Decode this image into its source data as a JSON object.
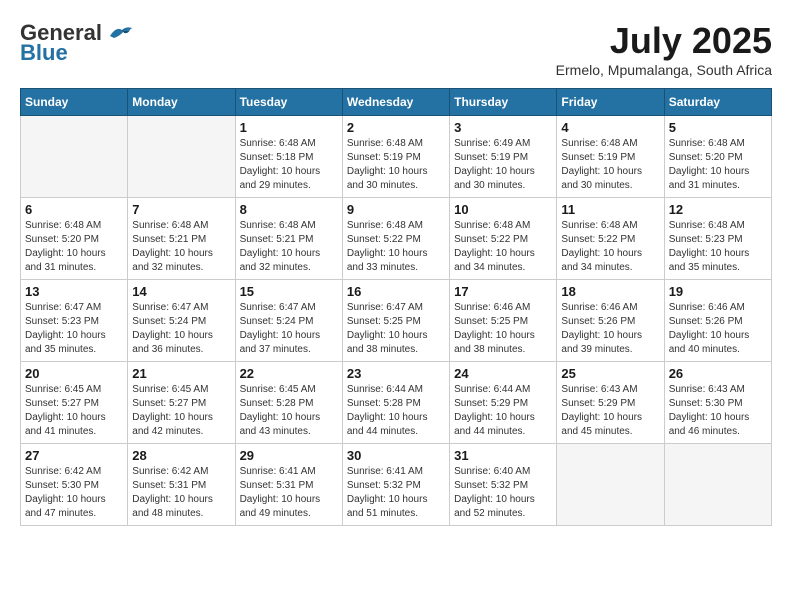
{
  "logo": {
    "general": "General",
    "blue": "Blue"
  },
  "title": {
    "month_year": "July 2025",
    "location": "Ermelo, Mpumalanga, South Africa"
  },
  "weekdays": [
    "Sunday",
    "Monday",
    "Tuesday",
    "Wednesday",
    "Thursday",
    "Friday",
    "Saturday"
  ],
  "weeks": [
    [
      {
        "day": "",
        "info": ""
      },
      {
        "day": "",
        "info": ""
      },
      {
        "day": "1",
        "info": "Sunrise: 6:48 AM\nSunset: 5:18 PM\nDaylight: 10 hours\nand 29 minutes."
      },
      {
        "day": "2",
        "info": "Sunrise: 6:48 AM\nSunset: 5:19 PM\nDaylight: 10 hours\nand 30 minutes."
      },
      {
        "day": "3",
        "info": "Sunrise: 6:49 AM\nSunset: 5:19 PM\nDaylight: 10 hours\nand 30 minutes."
      },
      {
        "day": "4",
        "info": "Sunrise: 6:48 AM\nSunset: 5:19 PM\nDaylight: 10 hours\nand 30 minutes."
      },
      {
        "day": "5",
        "info": "Sunrise: 6:48 AM\nSunset: 5:20 PM\nDaylight: 10 hours\nand 31 minutes."
      }
    ],
    [
      {
        "day": "6",
        "info": "Sunrise: 6:48 AM\nSunset: 5:20 PM\nDaylight: 10 hours\nand 31 minutes."
      },
      {
        "day": "7",
        "info": "Sunrise: 6:48 AM\nSunset: 5:21 PM\nDaylight: 10 hours\nand 32 minutes."
      },
      {
        "day": "8",
        "info": "Sunrise: 6:48 AM\nSunset: 5:21 PM\nDaylight: 10 hours\nand 32 minutes."
      },
      {
        "day": "9",
        "info": "Sunrise: 6:48 AM\nSunset: 5:22 PM\nDaylight: 10 hours\nand 33 minutes."
      },
      {
        "day": "10",
        "info": "Sunrise: 6:48 AM\nSunset: 5:22 PM\nDaylight: 10 hours\nand 34 minutes."
      },
      {
        "day": "11",
        "info": "Sunrise: 6:48 AM\nSunset: 5:22 PM\nDaylight: 10 hours\nand 34 minutes."
      },
      {
        "day": "12",
        "info": "Sunrise: 6:48 AM\nSunset: 5:23 PM\nDaylight: 10 hours\nand 35 minutes."
      }
    ],
    [
      {
        "day": "13",
        "info": "Sunrise: 6:47 AM\nSunset: 5:23 PM\nDaylight: 10 hours\nand 35 minutes."
      },
      {
        "day": "14",
        "info": "Sunrise: 6:47 AM\nSunset: 5:24 PM\nDaylight: 10 hours\nand 36 minutes."
      },
      {
        "day": "15",
        "info": "Sunrise: 6:47 AM\nSunset: 5:24 PM\nDaylight: 10 hours\nand 37 minutes."
      },
      {
        "day": "16",
        "info": "Sunrise: 6:47 AM\nSunset: 5:25 PM\nDaylight: 10 hours\nand 38 minutes."
      },
      {
        "day": "17",
        "info": "Sunrise: 6:46 AM\nSunset: 5:25 PM\nDaylight: 10 hours\nand 38 minutes."
      },
      {
        "day": "18",
        "info": "Sunrise: 6:46 AM\nSunset: 5:26 PM\nDaylight: 10 hours\nand 39 minutes."
      },
      {
        "day": "19",
        "info": "Sunrise: 6:46 AM\nSunset: 5:26 PM\nDaylight: 10 hours\nand 40 minutes."
      }
    ],
    [
      {
        "day": "20",
        "info": "Sunrise: 6:45 AM\nSunset: 5:27 PM\nDaylight: 10 hours\nand 41 minutes."
      },
      {
        "day": "21",
        "info": "Sunrise: 6:45 AM\nSunset: 5:27 PM\nDaylight: 10 hours\nand 42 minutes."
      },
      {
        "day": "22",
        "info": "Sunrise: 6:45 AM\nSunset: 5:28 PM\nDaylight: 10 hours\nand 43 minutes."
      },
      {
        "day": "23",
        "info": "Sunrise: 6:44 AM\nSunset: 5:28 PM\nDaylight: 10 hours\nand 44 minutes."
      },
      {
        "day": "24",
        "info": "Sunrise: 6:44 AM\nSunset: 5:29 PM\nDaylight: 10 hours\nand 44 minutes."
      },
      {
        "day": "25",
        "info": "Sunrise: 6:43 AM\nSunset: 5:29 PM\nDaylight: 10 hours\nand 45 minutes."
      },
      {
        "day": "26",
        "info": "Sunrise: 6:43 AM\nSunset: 5:30 PM\nDaylight: 10 hours\nand 46 minutes."
      }
    ],
    [
      {
        "day": "27",
        "info": "Sunrise: 6:42 AM\nSunset: 5:30 PM\nDaylight: 10 hours\nand 47 minutes."
      },
      {
        "day": "28",
        "info": "Sunrise: 6:42 AM\nSunset: 5:31 PM\nDaylight: 10 hours\nand 48 minutes."
      },
      {
        "day": "29",
        "info": "Sunrise: 6:41 AM\nSunset: 5:31 PM\nDaylight: 10 hours\nand 49 minutes."
      },
      {
        "day": "30",
        "info": "Sunrise: 6:41 AM\nSunset: 5:32 PM\nDaylight: 10 hours\nand 51 minutes."
      },
      {
        "day": "31",
        "info": "Sunrise: 6:40 AM\nSunset: 5:32 PM\nDaylight: 10 hours\nand 52 minutes."
      },
      {
        "day": "",
        "info": ""
      },
      {
        "day": "",
        "info": ""
      }
    ]
  ]
}
